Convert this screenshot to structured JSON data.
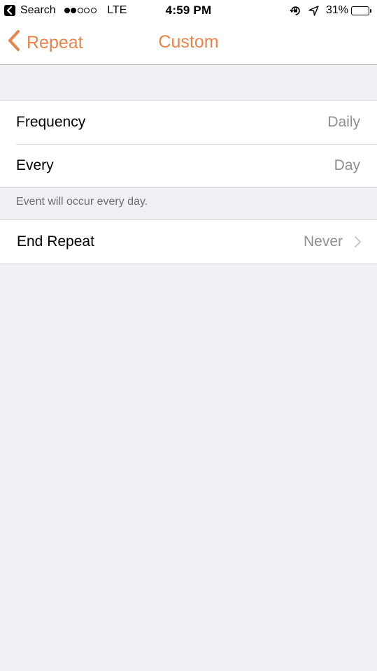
{
  "status_bar": {
    "back_app": "Search",
    "carrier": "LTE",
    "time": "4:59 PM",
    "battery_percent": "31%",
    "battery_level": 0.31
  },
  "nav": {
    "back_label": "Repeat",
    "title": "Custom"
  },
  "frequency_group": {
    "rows": [
      {
        "label": "Frequency",
        "value": "Daily"
      },
      {
        "label": "Every",
        "value": "Day"
      }
    ],
    "footer": "Event will occur every day."
  },
  "end_group": {
    "label": "End Repeat",
    "value": "Never"
  },
  "colors": {
    "accent": "#e8834a",
    "background": "#efeff4",
    "secondary_text": "#8e8e93"
  }
}
